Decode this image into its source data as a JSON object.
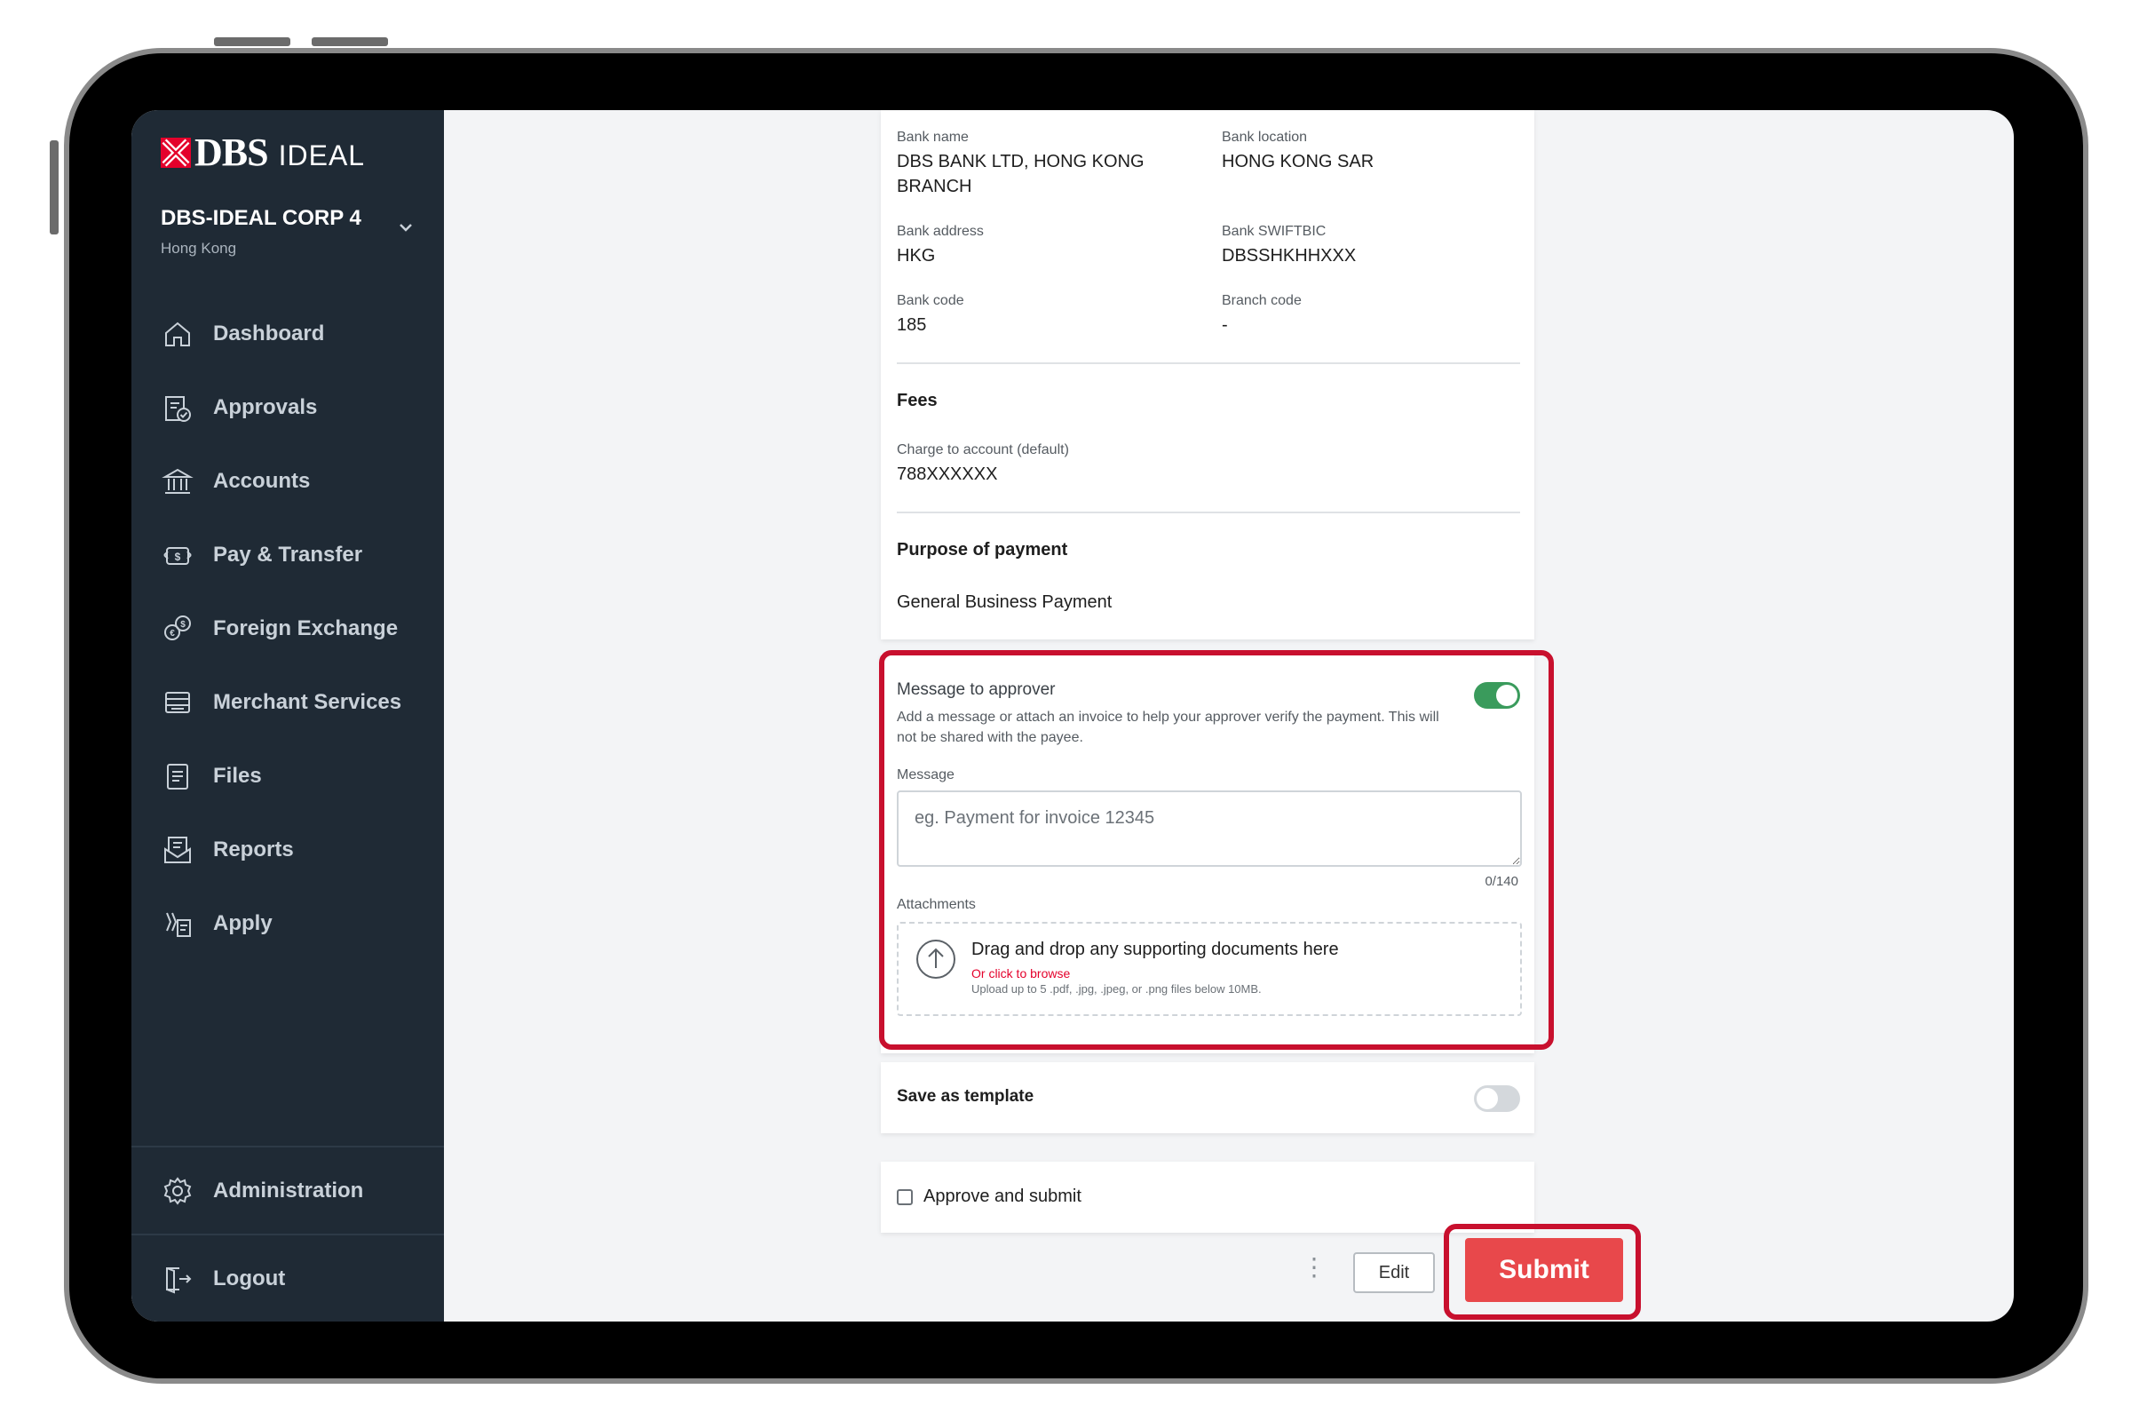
{
  "brand": {
    "logo_text": "DBS",
    "product": "IDEAL",
    "logo_color": "#e4002b"
  },
  "org": {
    "name": "DBS-IDEAL CORP 4",
    "region": "Hong Kong"
  },
  "nav": {
    "items": [
      {
        "label": "Dashboard",
        "icon": "home-icon"
      },
      {
        "label": "Approvals",
        "icon": "approvals-icon"
      },
      {
        "label": "Accounts",
        "icon": "bank-icon"
      },
      {
        "label": "Pay & Transfer",
        "icon": "transfer-icon"
      },
      {
        "label": "Foreign Exchange",
        "icon": "currency-exchange-icon"
      },
      {
        "label": "Merchant Services",
        "icon": "merchant-icon"
      },
      {
        "label": "Files",
        "icon": "file-icon"
      },
      {
        "label": "Reports",
        "icon": "report-icon"
      },
      {
        "label": "Apply",
        "icon": "apply-icon"
      }
    ],
    "administration": "Administration",
    "logout": "Logout"
  },
  "bank": {
    "name_label": "Bank name",
    "name_value": "DBS BANK LTD, HONG KONG BRANCH",
    "location_label": "Bank location",
    "location_value": "HONG KONG SAR",
    "address_label": "Bank address",
    "address_value": "HKG",
    "swift_label": "Bank SWIFTBIC",
    "swift_value": "DBSSHKHHXXX",
    "code_label": "Bank code",
    "code_value": "185",
    "branch_label": "Branch code",
    "branch_value": "-"
  },
  "fees": {
    "title": "Fees",
    "charge_label": "Charge to account (default)",
    "charge_value": "788XXXXXX"
  },
  "purpose": {
    "title": "Purpose of payment",
    "value": "General Business Payment"
  },
  "approver_message": {
    "title": "Message to approver",
    "description": "Add a message or attach an invoice to help your approver verify the payment. This will not be shared with the payee.",
    "toggle_on": true,
    "message_label": "Message",
    "message_placeholder": "eg. Payment for invoice 12345",
    "char_count": "0/140",
    "attachments_label": "Attachments",
    "drop_title": "Drag and drop any supporting documents here",
    "browse_link": "Or click to browse",
    "upload_hint": "Upload up to 5 .pdf, .jpg, .jpeg, or .png files below 10MB."
  },
  "template": {
    "label": "Save as template",
    "toggle_on": false
  },
  "approve": {
    "label": "Approve and submit",
    "checked": false
  },
  "actions": {
    "more": "⋮",
    "edit": "Edit",
    "submit": "Submit"
  },
  "colors": {
    "accent_red": "#c8102e",
    "submit_red": "#e8484b",
    "toggle_green": "#3a9b5c",
    "sidebar": "#1f2a35"
  }
}
